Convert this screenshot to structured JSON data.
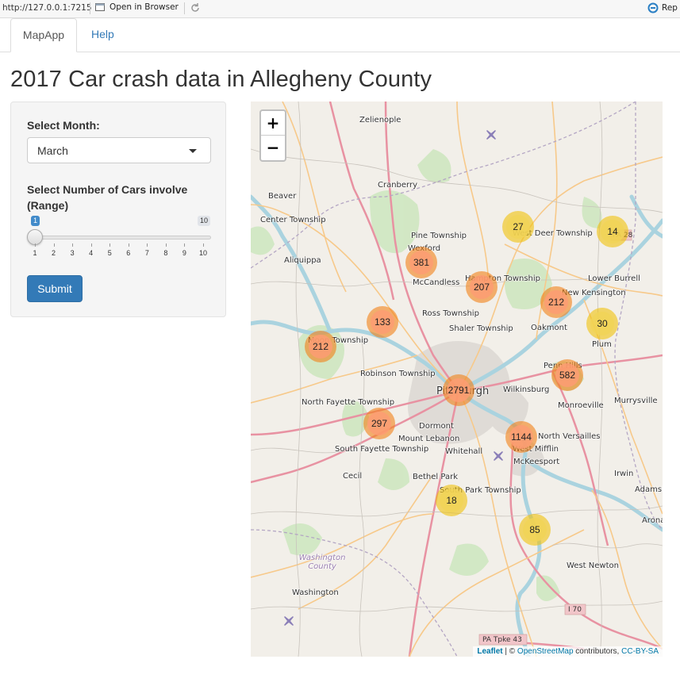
{
  "browser": {
    "url": "http://127.0.0.1:7215",
    "open_in_browser": "Open in Browser",
    "rep": "Rep"
  },
  "tabs": [
    {
      "label": "MapApp",
      "active": true
    },
    {
      "label": "Help",
      "active": false
    }
  ],
  "page_title": "2017 Car crash data in Allegheny County",
  "sidebar": {
    "month_label": "Select Month:",
    "month_value": "March",
    "cars_label": "Select Number of Cars involve (Range)",
    "slider": {
      "min": 1,
      "max": 10,
      "value_low": 1,
      "value_high": 10,
      "ticks": [
        "1",
        "2",
        "3",
        "4",
        "5",
        "6",
        "7",
        "8",
        "9",
        "10"
      ]
    },
    "submit_label": "Submit"
  },
  "map": {
    "zoom_in": "+",
    "zoom_out": "−",
    "clusters": [
      {
        "count": "27",
        "level": "small"
      },
      {
        "count": "14",
        "level": "small"
      },
      {
        "count": "381",
        "level": "medium"
      },
      {
        "count": "207",
        "level": "medium"
      },
      {
        "count": "212",
        "level": "medium"
      },
      {
        "count": "30",
        "level": "small"
      },
      {
        "count": "133",
        "level": "medium"
      },
      {
        "count": "212",
        "level": "medium"
      },
      {
        "count": "582",
        "level": "medium"
      },
      {
        "count": "2791",
        "level": "large"
      },
      {
        "count": "297",
        "level": "medium"
      },
      {
        "count": "1144",
        "level": "large"
      },
      {
        "count": "18",
        "level": "small"
      },
      {
        "count": "85",
        "level": "small"
      }
    ],
    "places": [
      "Zelienople",
      "Cranberry",
      "Beaver",
      "Center Township",
      "Aliquippa",
      "Pine Township",
      "Wexford",
      "McCandless",
      "Hampton Township",
      "West Deer Township",
      "Lower Burrell",
      "New Kensington",
      "Oakmont",
      "Plum",
      "Ross Township",
      "Shaler Township",
      "Moon Township",
      "Robinson Township",
      "Penn Hills",
      "Pittsburgh",
      "Wilkinsburg",
      "Monroeville",
      "Murrysville",
      "North Fayette Township",
      "Dormont",
      "Mount Lebanon",
      "North Versailles",
      "West Mifflin",
      "McKeesport",
      "South Fayette Township",
      "Whitehall",
      "Cecil",
      "Bethel Park",
      "South Park Township",
      "Irwin",
      "Adamsb",
      "Arona",
      "West Newton",
      "Washington County",
      "Washington",
      "I 70",
      "PA Tpke 43",
      "PA 28"
    ],
    "attribution": {
      "leaflet": "Leaflet",
      "sep": " | © ",
      "osm": "OpenStreetMap",
      "contributors": " contributors, ",
      "license": "CC-BY-SA"
    }
  },
  "colors": {
    "small": "#f1d357",
    "medium": "#fd9c73",
    "large": "#fd9c73",
    "accent": "#337ab7"
  }
}
